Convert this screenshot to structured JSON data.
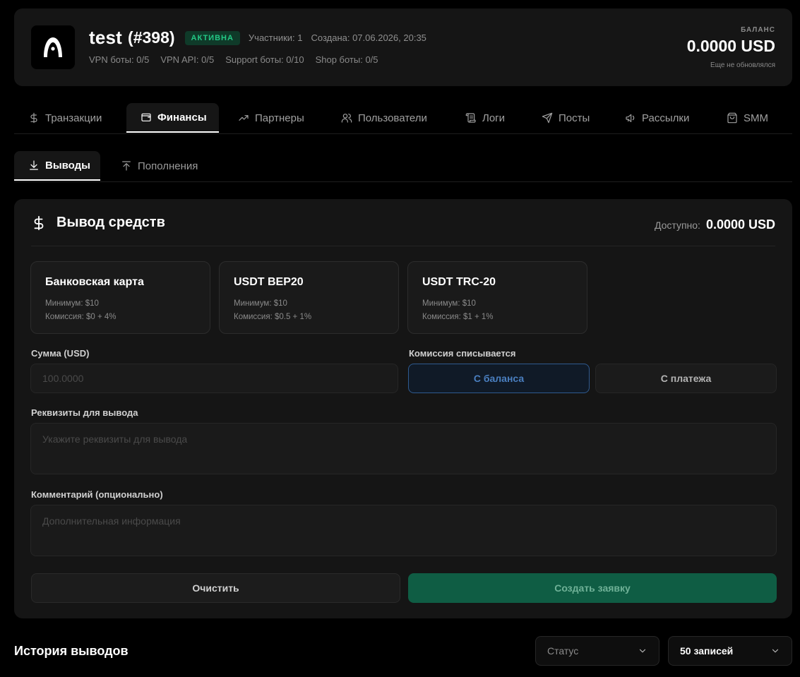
{
  "header": {
    "title": "test",
    "id_label": "(#398)",
    "status_badge": "АКТИВНА",
    "members": "Участники: 1",
    "created": "Создана: 07.06.2026, 20:35",
    "limits": {
      "vpn_bots": "VPN боты: 0/5",
      "vpn_api": "VPN API: 0/5",
      "support_bots": "Support боты: 0/10",
      "shop_bots": "Shop боты: 0/5"
    },
    "balance_label": "БАЛАНС",
    "balance_value": "0.0000 USD",
    "balance_note": "Еще не обновлялся"
  },
  "main_tabs": [
    {
      "label": "Транзакции",
      "icon": "dollar-icon"
    },
    {
      "label": "Финансы",
      "icon": "wallet-icon",
      "active": true
    },
    {
      "label": "Партнеры",
      "icon": "trending-up-icon"
    },
    {
      "label": "Пользователи",
      "icon": "users-icon"
    },
    {
      "label": "Логи",
      "icon": "scroll-icon"
    },
    {
      "label": "Посты",
      "icon": "send-icon"
    },
    {
      "label": "Рассылки",
      "icon": "megaphone-icon"
    },
    {
      "label": "SMM",
      "icon": "shopping-bag-icon"
    }
  ],
  "sub_tabs": [
    {
      "label": "Выводы",
      "icon": "download-icon",
      "active": true
    },
    {
      "label": "Пополнения",
      "icon": "upload-icon"
    }
  ],
  "withdraw": {
    "title": "Вывод средств",
    "available_label": "Доступно:",
    "available_value": "0.0000 USD",
    "methods": [
      {
        "name": "Банковская карта",
        "min": "Минимум: $10",
        "fee": "Комиссия: $0 + 4%"
      },
      {
        "name": "USDT BEP20",
        "min": "Минимум: $10",
        "fee": "Комиссия: $0.5 + 1%"
      },
      {
        "name": "USDT TRC-20",
        "min": "Минимум: $10",
        "fee": "Комиссия: $1 + 1%"
      }
    ],
    "amount_label": "Сумма (USD)",
    "amount_placeholder": "100.0000",
    "fee_label": "Комиссия списывается",
    "fee_from_balance": "С баланса",
    "fee_from_payment": "С платежа",
    "details_label": "Реквизиты для вывода",
    "details_placeholder": "Укажите реквизиты для вывода",
    "comment_label": "Комментарий (опционально)",
    "comment_placeholder": "Дополнительная информация",
    "clear_button": "Очистить",
    "create_button": "Создать заявку"
  },
  "history": {
    "title": "История выводов",
    "status_select": "Статус",
    "records_select": "50 записей"
  },
  "colors": {
    "accent_green": "#0f5d44",
    "badge_green": "#23c885",
    "toggle_blue": "#2f5a8f"
  }
}
